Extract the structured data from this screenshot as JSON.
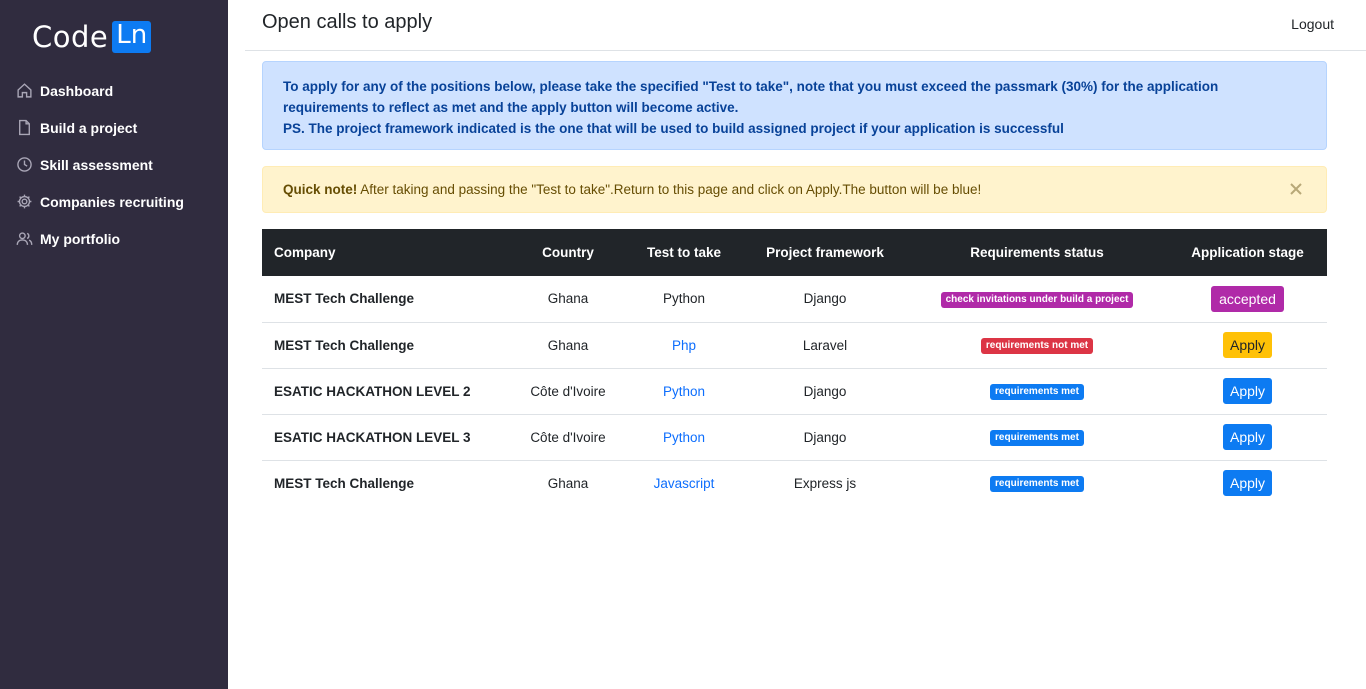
{
  "logo": {
    "code": "Code",
    "ln": "Ln"
  },
  "sidebar": {
    "items": [
      {
        "label": "Dashboard",
        "icon": "home-icon"
      },
      {
        "label": "Build a project",
        "icon": "document-icon"
      },
      {
        "label": "Skill assessment",
        "icon": "clock-icon"
      },
      {
        "label": "Companies recruiting",
        "icon": "gear-icon"
      },
      {
        "label": "My portfolio",
        "icon": "users-icon"
      }
    ]
  },
  "header": {
    "title": "Open calls to apply",
    "logout": "Logout"
  },
  "info_alert": {
    "line1": "To apply for any of the positions below, please take the specified \"Test to take\", note that you must exceed the passmark (30%) for the application requirements to reflect as met and the apply button will become active.",
    "line2": "PS. The project framework indicated is the one that will be used to build assigned project if your application is successful"
  },
  "warning_alert": {
    "strong": "Quick note!",
    "text": " After taking and passing the \"Test to take\".Return to this page and click on Apply.The button will be blue!"
  },
  "table": {
    "headers": [
      "Company",
      "Country",
      "Test to take",
      "Project framework",
      "Requirements status",
      "Application stage"
    ],
    "rows": [
      {
        "company": "MEST Tech Challenge",
        "country": "Ghana",
        "test": "Python",
        "framework": "Django",
        "status": "check invitations under build a project",
        "stage": "accepted"
      },
      {
        "company": "MEST Tech Challenge",
        "country": "Ghana",
        "test": "Php",
        "framework": "Laravel",
        "status": "requirements not met",
        "stage": "Apply"
      },
      {
        "company": "ESATIC HACKATHON LEVEL 2",
        "country": "Côte d'Ivoire",
        "test": "Python",
        "framework": "Django",
        "status": "requirements met",
        "stage": "Apply"
      },
      {
        "company": "ESATIC HACKATHON LEVEL 3",
        "country": "Côte d'Ivoire",
        "test": "Python",
        "framework": "Django",
        "status": "requirements met",
        "stage": "Apply"
      },
      {
        "company": "MEST Tech Challenge",
        "country": "Ghana",
        "test": "Javascript",
        "framework": "Express js",
        "status": "requirements met",
        "stage": "Apply"
      }
    ]
  },
  "colors": {
    "sidebar_bg": "#302c3f",
    "primary": "#0d7bf2",
    "accepted": "#b02aa8",
    "danger": "#dc3545",
    "warning": "#ffc107",
    "table_header": "#212529"
  }
}
